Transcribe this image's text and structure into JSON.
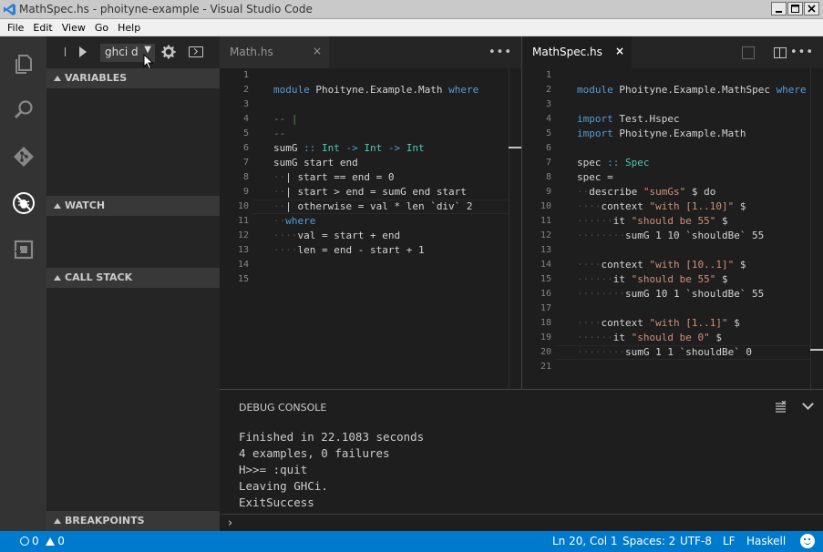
{
  "window": {
    "title": "MathSpec.hs - phoityne-example - Visual Studio Code"
  },
  "menu": [
    "File",
    "Edit",
    "View",
    "Go",
    "Help"
  ],
  "activity": [
    "explorer-icon",
    "search-icon",
    "git-icon",
    "debug-icon",
    "extensions-icon"
  ],
  "debug": {
    "config_label": "ghci d",
    "config_caret": "▼",
    "sections": {
      "variables": "VARIABLES",
      "watch": "WATCH",
      "call_stack": "CALL STACK",
      "breakpoints": "BREAKPOINTS"
    }
  },
  "editors": {
    "left": {
      "tab": "Math.hs",
      "close": "×",
      "lines": [
        {
          "n": "1",
          "html": ""
        },
        {
          "n": "2",
          "html": "<span class=\"kw\">module</span> Phoityne.Example.Math <span class=\"kw\">where</span>"
        },
        {
          "n": "3",
          "html": ""
        },
        {
          "n": "4",
          "html": "<span class=\"cm\">-- |</span>"
        },
        {
          "n": "5",
          "html": "<span class=\"cm\">--</span>"
        },
        {
          "n": "6",
          "html": "sumG <span class=\"kw\">::</span> <span class=\"ty\">Int</span> <span class=\"kw\">-&gt;</span> <span class=\"ty\">Int</span> <span class=\"kw\">-&gt;</span> <span class=\"ty\">Int</span>"
        },
        {
          "n": "7",
          "html": "sumG start end"
        },
        {
          "n": "8",
          "html": "<span class=\"ws\">··</span>| start == end = 0"
        },
        {
          "n": "9",
          "html": "<span class=\"ws\">··</span>| start &gt; end = sumG end start"
        },
        {
          "n": "10",
          "html": "<span class=\"ws\">··</span>| otherwise = val * len `div` 2"
        },
        {
          "n": "11",
          "html": "<span class=\"ws\">··</span><span class=\"kw\">where</span>"
        },
        {
          "n": "12",
          "html": "<span class=\"ws\">····</span>val = start + end"
        },
        {
          "n": "13",
          "html": "<span class=\"ws\">····</span>len = end - start + 1"
        },
        {
          "n": "14",
          "html": ""
        },
        {
          "n": "15",
          "html": ""
        }
      ]
    },
    "right": {
      "tab": "MathSpec.hs",
      "close": "×",
      "lines": [
        {
          "n": "1",
          "html": ""
        },
        {
          "n": "2",
          "html": "<span class=\"kw\">module</span> Phoityne.Example.MathSpec <span class=\"kw\">where</span>"
        },
        {
          "n": "3",
          "html": ""
        },
        {
          "n": "4",
          "html": "<span class=\"kw\">import</span> Test.Hspec"
        },
        {
          "n": "5",
          "html": "<span class=\"kw\">import</span> Phoityne.Example.Math"
        },
        {
          "n": "6",
          "html": ""
        },
        {
          "n": "7",
          "html": "spec <span class=\"kw\">::</span> <span class=\"ty\">Spec</span>"
        },
        {
          "n": "8",
          "html": "spec ="
        },
        {
          "n": "9",
          "html": "<span class=\"ws\">··</span>describe <span class=\"str\">\"sumGs\"</span> $ do"
        },
        {
          "n": "10",
          "html": "<span class=\"ws\">····</span>context <span class=\"str\">\"with [1..10]\"</span> $"
        },
        {
          "n": "11",
          "html": "<span class=\"ws\">······</span>it <span class=\"str\">\"should be 55\"</span> $"
        },
        {
          "n": "12",
          "html": "<span class=\"ws\">········</span>sumG 1 10 `shouldBe` 55"
        },
        {
          "n": "13",
          "html": ""
        },
        {
          "n": "14",
          "html": "<span class=\"ws\">····</span>context <span class=\"str\">\"with [10..1]\"</span> $"
        },
        {
          "n": "15",
          "html": "<span class=\"ws\">······</span>it <span class=\"str\">\"should be 55\"</span> $"
        },
        {
          "n": "16",
          "html": "<span class=\"ws\">········</span>sumG 10 1 `shouldBe` 55"
        },
        {
          "n": "17",
          "html": ""
        },
        {
          "n": "18",
          "html": "<span class=\"ws\">····</span>context <span class=\"str\">\"with [1..1]\"</span> $"
        },
        {
          "n": "19",
          "html": "<span class=\"ws\">······</span>it <span class=\"str\">\"should be 0\"</span> $"
        },
        {
          "n": "20",
          "html": "<span class=\"ws\">········</span>sumG 1 1 `shouldBe` 0"
        },
        {
          "n": "21",
          "html": ""
        }
      ]
    }
  },
  "panel": {
    "title": "DEBUG CONSOLE",
    "output": [
      "Finished in 22.1083 seconds",
      "4 examples, 0 failures",
      "H>>= :quit",
      "Leaving GHCi.",
      "ExitSuccess"
    ],
    "prompt": "›"
  },
  "status": {
    "errors": "0",
    "warnings": "0",
    "position": "Ln 20, Col 1",
    "spaces": "Spaces: 2",
    "encoding": "UTF-8",
    "eol": "LF",
    "language": "Haskell"
  },
  "colors": {
    "statusbar": "#007acc",
    "keyword": "#569cd6",
    "type": "#4ec9b0",
    "string": "#ce9178",
    "comment": "#608b4e"
  }
}
